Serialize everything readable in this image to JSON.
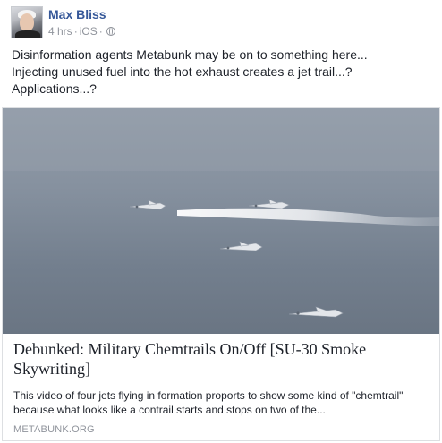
{
  "post": {
    "author": "Max Bliss",
    "time": "4 hrs",
    "separator": "·",
    "platform": "iOS",
    "privacy_icon": "globe-icon",
    "text_lines": [
      "Disinformation agents Metabunk may be on to something here...",
      "Injecting unused fuel into the hot exhaust creates a jet trail...?",
      "Applications...?"
    ]
  },
  "link_card": {
    "thumbnail": "video-thumbnail-jets-in-formation",
    "title_lines": [
      "Debunked: Military Chemtrails On/Off [SU-30 Smoke",
      "Skywriting]"
    ],
    "description_lines": [
      "This video of four jets flying in formation proports to show some kind of \"chemtrail\"",
      "because what looks like a contrail starts and stops on two of the..."
    ],
    "domain": "METABUNK.ORG"
  },
  "colors": {
    "author_link": "#365899",
    "meta_text": "#90949c",
    "body_text": "#1d2129",
    "card_border": "#dddfe2"
  }
}
